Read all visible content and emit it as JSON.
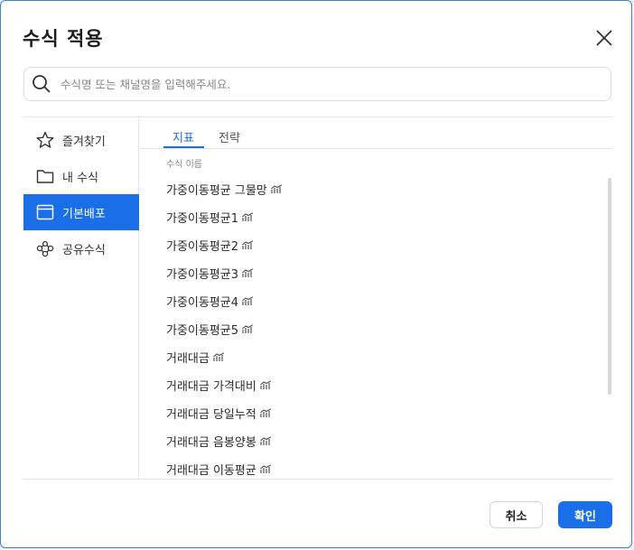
{
  "dialog": {
    "title": "수식 적용",
    "close_icon": "close-icon"
  },
  "search": {
    "placeholder": "수식명 또는 채널명을 입력해주세요.",
    "value": "",
    "icon": "search-icon"
  },
  "sidebar": {
    "items": [
      {
        "label": "즐겨찾기",
        "icon": "star-icon",
        "active": false
      },
      {
        "label": "내 수식",
        "icon": "folder-icon",
        "active": false
      },
      {
        "label": "기본배포",
        "icon": "window-icon",
        "active": true
      },
      {
        "label": "공유수식",
        "icon": "share-icon",
        "active": false
      }
    ]
  },
  "tabs": [
    {
      "label": "지표",
      "active": true
    },
    {
      "label": "전략",
      "active": false
    }
  ],
  "list": {
    "column_header": "수식 이름",
    "rows": [
      "가중이동평균 그물망",
      "가중이동평균1",
      "가중이동평균2",
      "가중이동평균3",
      "가중이동평균4",
      "가중이동평균5",
      "거래대금",
      "거래대금 가격대비",
      "거래대금 당일누적",
      "거래대금 음봉양봉",
      "거래대금 이동평균"
    ],
    "row_icon": "indicator-chart-icon"
  },
  "buttons": {
    "cancel": "취소",
    "ok": "확인"
  },
  "colors": {
    "accent": "#1a6fe8",
    "border": "#3b7fd9"
  }
}
